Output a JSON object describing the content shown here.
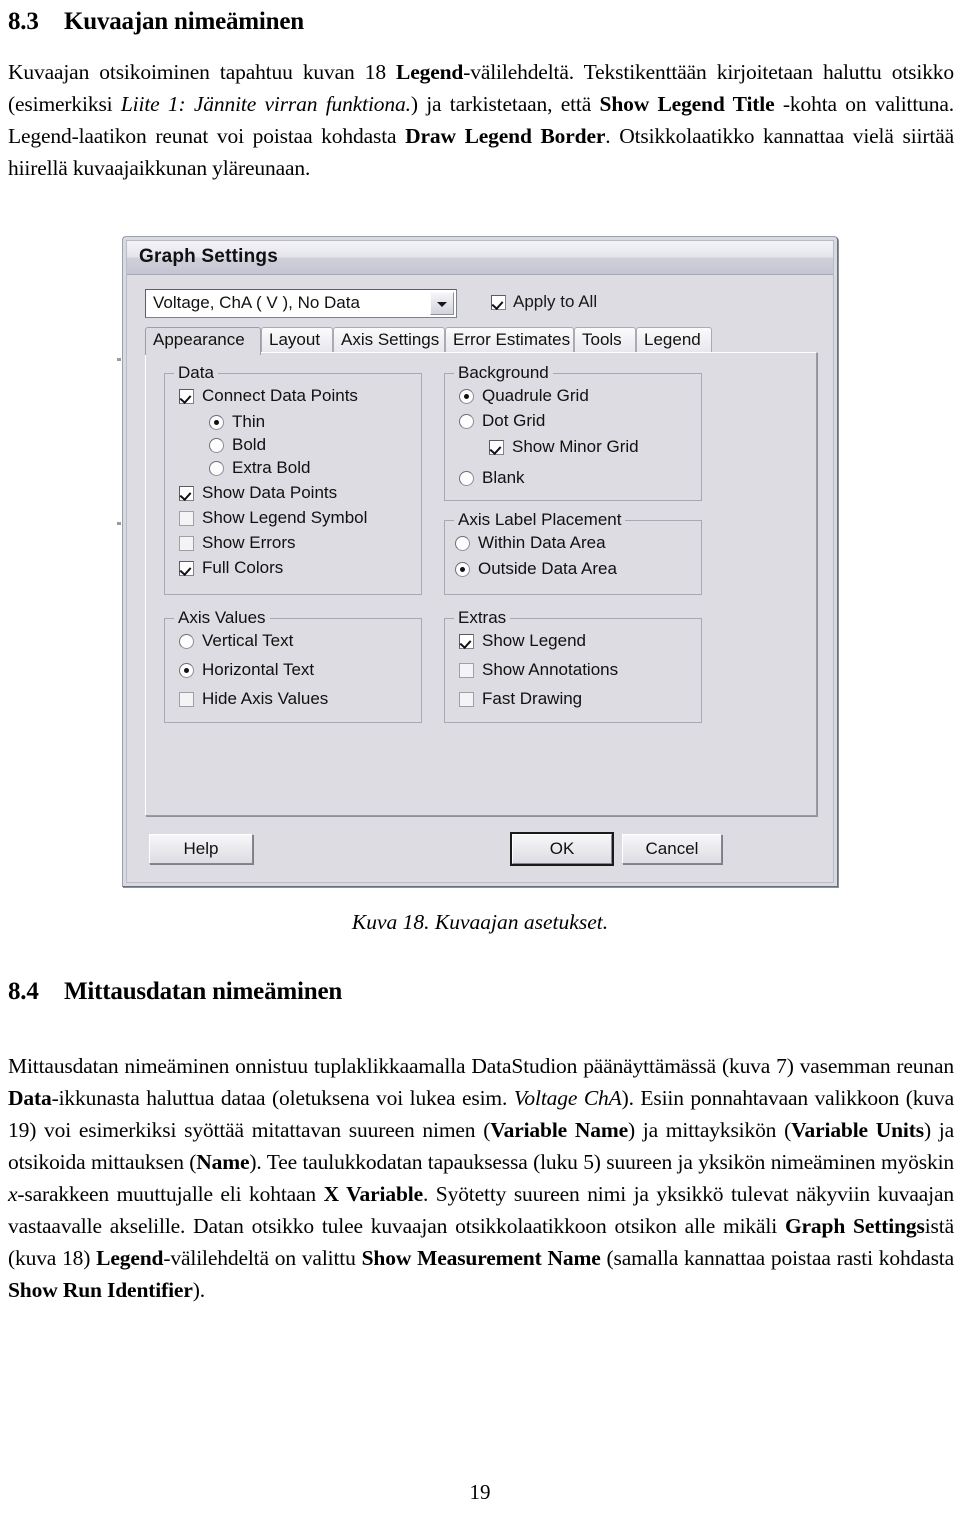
{
  "document": {
    "heading_83": {
      "number": "8.3",
      "text": "Kuvaajan nimeäminen"
    },
    "paragraph_83_runs": [
      {
        "t": "Kuvaajan otsikoiminen tapahtuu kuvan 18 ",
        "s": "n"
      },
      {
        "t": "Legend",
        "s": "b"
      },
      {
        "t": "-välilehdeltä. Tekstikenttään kirjoitetaan haluttu otsikko (esimerkiksi ",
        "s": "n"
      },
      {
        "t": "Liite 1: Jännite virran funktiona.",
        "s": "i"
      },
      {
        "t": ") ja tarkistetaan, että ",
        "s": "n"
      },
      {
        "t": "Show Legend Title",
        "s": "b"
      },
      {
        "t": " -kohta on valittuna. Legend-laatikon reunat voi poistaa kohdasta ",
        "s": "n"
      },
      {
        "t": "Draw Legend Border",
        "s": "b"
      },
      {
        "t": ". Otsikkolaatikko kannattaa vielä siirtää hiirellä kuvaajaikkunan yläreunaan.",
        "s": "n"
      }
    ],
    "figure_caption": "Kuva 18. Kuvaajan asetukset.",
    "heading_84": {
      "number": "8.4",
      "text": "Mittausdatan nimeäminen"
    },
    "paragraph_84_runs": [
      {
        "t": "Mittausdatan nimeäminen onnistuu tuplaklikkaamalla DataStudion päänäyttämässä (kuva 7) vasemman reunan ",
        "s": "n"
      },
      {
        "t": "Data",
        "s": "b"
      },
      {
        "t": "-ikkunasta haluttua dataa (oletuksena voi lukea esim. ",
        "s": "n"
      },
      {
        "t": "Voltage ChA",
        "s": "i"
      },
      {
        "t": "). Esiin ponnahtavaan valikkoon (kuva 19) voi esimerkiksi syöttää mitattavan suureen nimen (",
        "s": "n"
      },
      {
        "t": "Variable Name",
        "s": "b"
      },
      {
        "t": ") ja mittayksikön (",
        "s": "n"
      },
      {
        "t": "Variable Units",
        "s": "b"
      },
      {
        "t": ") ja otsikoida mittauksen (",
        "s": "n"
      },
      {
        "t": "Name",
        "s": "b"
      },
      {
        "t": "). Tee taulukkodatan tapauksessa (luku 5) suureen ja yksikön nimeäminen myöskin ",
        "s": "n"
      },
      {
        "t": "x",
        "s": "i"
      },
      {
        "t": "-sarakkeen muuttujalle eli kohtaan ",
        "s": "n"
      },
      {
        "t": "X Variable",
        "s": "b"
      },
      {
        "t": ". Syötetty suureen nimi ja yksikkö tulevat näkyviin kuvaajan vastaavalle akselille. Datan otsikko tulee kuvaajan otsikkolaatikkoon otsikon alle mikäli ",
        "s": "n"
      },
      {
        "t": "Graph Settings",
        "s": "b"
      },
      {
        "t": "istä (kuva 18) ",
        "s": "n"
      },
      {
        "t": "Legend",
        "s": "b"
      },
      {
        "t": "-välilehdeltä on valittu ",
        "s": "n"
      },
      {
        "t": "Show Measurement Name",
        "s": "b"
      },
      {
        "t": " (samalla kannattaa poistaa rasti kohdasta ",
        "s": "n"
      },
      {
        "t": "Show Run Identifier",
        "s": "b"
      },
      {
        "t": ").",
        "s": "n"
      }
    ],
    "page_number": "19"
  },
  "dialog": {
    "title": "Graph Settings",
    "combo": {
      "value": "Voltage, ChA ( V ), No Data",
      "arrow_icon": "chevron-down-icon"
    },
    "apply_to_all": {
      "label": "Apply to All",
      "checked": true
    },
    "tabs": [
      {
        "label": "Appearance",
        "active": true
      },
      {
        "label": "Layout",
        "active": false
      },
      {
        "label": "Axis Settings",
        "active": false
      },
      {
        "label": "Error Estimates",
        "active": false
      },
      {
        "label": "Tools",
        "active": false
      },
      {
        "label": "Legend",
        "active": false
      }
    ],
    "groups": {
      "data": {
        "label": "Data",
        "items": [
          {
            "type": "checkbox",
            "label": "Connect Data Points",
            "checked": true,
            "indent": 0
          },
          {
            "type": "radio",
            "label": "Thin",
            "checked": true,
            "indent": 1
          },
          {
            "type": "radio",
            "label": "Bold",
            "checked": false,
            "indent": 1
          },
          {
            "type": "radio",
            "label": "Extra Bold",
            "checked": false,
            "indent": 1
          },
          {
            "type": "checkbox",
            "label": "Show Data Points",
            "checked": true,
            "indent": 0
          },
          {
            "type": "checkbox",
            "label": "Show Legend Symbol",
            "checked": false,
            "indent": 0
          },
          {
            "type": "checkbox",
            "label": "Show Errors",
            "checked": false,
            "indent": 0
          },
          {
            "type": "checkbox",
            "label": "Full Colors",
            "checked": true,
            "indent": 0
          }
        ]
      },
      "background": {
        "label": "Background",
        "items": [
          {
            "type": "radio",
            "label": "Quadrule Grid",
            "checked": true,
            "indent": 0
          },
          {
            "type": "radio",
            "label": "Dot Grid",
            "checked": false,
            "indent": 0
          },
          {
            "type": "checkbox",
            "label": "Show Minor Grid",
            "checked": true,
            "indent": 1
          },
          {
            "type": "radio",
            "label": "Blank",
            "checked": false,
            "indent": 0
          }
        ]
      },
      "axis_label_placement": {
        "label": "Axis Label Placement",
        "items": [
          {
            "type": "radio",
            "label": "Within Data Area",
            "checked": false,
            "indent": 0
          },
          {
            "type": "radio",
            "label": "Outside Data Area",
            "checked": true,
            "indent": 0
          }
        ]
      },
      "axis_values": {
        "label": "Axis Values",
        "items": [
          {
            "type": "radio",
            "label": "Vertical Text",
            "checked": false,
            "indent": 0
          },
          {
            "type": "radio",
            "label": "Horizontal Text",
            "checked": true,
            "indent": 0
          },
          {
            "type": "checkbox",
            "label": "Hide Axis Values",
            "checked": false,
            "indent": 0
          }
        ]
      },
      "extras": {
        "label": "Extras",
        "items": [
          {
            "type": "checkbox",
            "label": "Show Legend",
            "checked": true,
            "indent": 0
          },
          {
            "type": "checkbox",
            "label": "Show Annotations",
            "checked": false,
            "indent": 0
          },
          {
            "type": "checkbox",
            "label": "Fast Drawing",
            "checked": false,
            "indent": 0
          }
        ]
      }
    },
    "buttons": {
      "help": "Help",
      "ok": "OK",
      "cancel": "Cancel"
    }
  }
}
